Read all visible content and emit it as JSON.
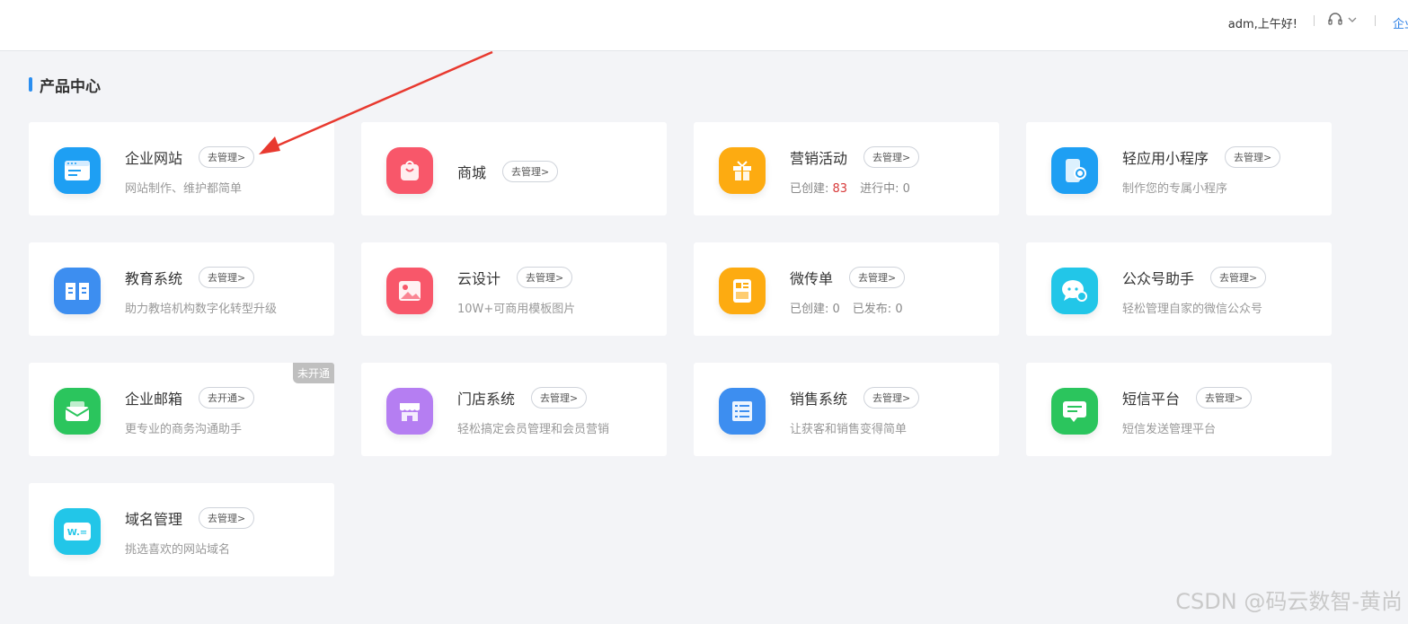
{
  "header": {
    "greeting": "adm,上午好!",
    "enterprise_label": "企业"
  },
  "section": {
    "title": "产品中心"
  },
  "cards": [
    {
      "name": "企业网站",
      "action": "去管理>",
      "desc": "网站制作、维护都简单",
      "icon": "website-icon",
      "color": "#1e9ff3"
    },
    {
      "name": "商城",
      "action": "去管理>",
      "icon": "shopping-bag-icon",
      "color": "#f8576a"
    },
    {
      "name": "营销活动",
      "action": "去管理>",
      "icon": "gift-icon",
      "color": "#fdab11",
      "stats": {
        "created_label": "已创建:",
        "created_value": "83",
        "running_label": "进行中:",
        "running_value": "0"
      }
    },
    {
      "name": "轻应用小程序",
      "action": "去管理>",
      "desc": "制作您的专属小程序",
      "icon": "mini-program-icon",
      "color": "#1e9ff3"
    },
    {
      "name": "教育系统",
      "action": "去管理>",
      "desc": "助力教培机构数字化转型升级",
      "icon": "book-icon",
      "color": "#3d8ef0"
    },
    {
      "name": "云设计",
      "action": "去管理>",
      "desc": "10W+可商用模板图片",
      "icon": "image-icon",
      "color": "#f8576a"
    },
    {
      "name": "微传单",
      "action": "去管理>",
      "icon": "flyer-icon",
      "color": "#fdab11",
      "stats": {
        "created_label": "已创建:",
        "created_value": "0",
        "running_label": "已发布:",
        "running_value": "0"
      }
    },
    {
      "name": "公众号助手",
      "action": "去管理>",
      "desc": "轻松管理自家的微信公众号",
      "icon": "wechat-chat-icon",
      "color": "#22c6e8"
    },
    {
      "name": "企业邮箱",
      "action": "去开通>",
      "desc": "更专业的商务沟通助手",
      "icon": "mail-icon",
      "color": "#2bc55d",
      "badge": "未开通"
    },
    {
      "name": "门店系统",
      "action": "去管理>",
      "desc": "轻松搞定会员管理和会员营销",
      "icon": "store-icon",
      "color": "#b57ef2"
    },
    {
      "name": "销售系统",
      "action": "去管理>",
      "desc": "让获客和销售变得简单",
      "icon": "list-icon",
      "color": "#3d8ef0"
    },
    {
      "name": "短信平台",
      "action": "去管理>",
      "desc": "短信发送管理平台",
      "icon": "sms-icon",
      "color": "#2bc55d"
    },
    {
      "name": "域名管理",
      "action": "去管理>",
      "desc": "挑选喜欢的网站域名",
      "icon": "domain-icon",
      "color": "#22c6e8",
      "icon_text": "W.="
    }
  ],
  "watermark": "CSDN @码云数智-黄尚"
}
